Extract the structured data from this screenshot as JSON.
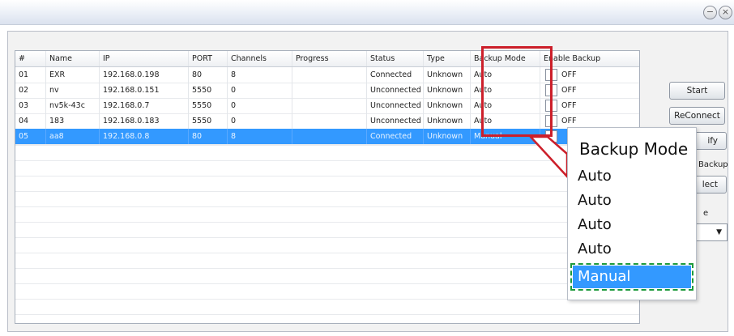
{
  "window": {
    "minimize_icon": "minimize-icon",
    "close_icon": "close-icon"
  },
  "table": {
    "headers": [
      "#",
      "Name",
      "IP",
      "PORT",
      "Channels",
      "Progress",
      "Status",
      "Type",
      "Backup Mode",
      "Enable Backup"
    ],
    "rows": [
      {
        "num": "01",
        "name": "EXR",
        "ip": "192.168.0.198",
        "port": "80",
        "channels": "8",
        "progress": "",
        "status": "Connected",
        "type": "Unknown",
        "backup_mode": "Auto",
        "enable_backup": "OFF"
      },
      {
        "num": "02",
        "name": "nv",
        "ip": "192.168.0.151",
        "port": "5550",
        "channels": "0",
        "progress": "",
        "status": "Unconnected",
        "type": "Unknown",
        "backup_mode": "Auto",
        "enable_backup": "OFF"
      },
      {
        "num": "03",
        "name": "nv5k-43c",
        "ip": "192.168.0.7",
        "port": "5550",
        "channels": "0",
        "progress": "",
        "status": "Unconnected",
        "type": "Unknown",
        "backup_mode": "Auto",
        "enable_backup": "OFF"
      },
      {
        "num": "04",
        "name": "183",
        "ip": "192.168.0.183",
        "port": "5550",
        "channels": "0",
        "progress": "",
        "status": "Unconnected",
        "type": "Unknown",
        "backup_mode": "Auto",
        "enable_backup": "OFF"
      },
      {
        "num": "05",
        "name": "aa8",
        "ip": "192.168.0.8",
        "port": "80",
        "channels": "8",
        "progress": "",
        "status": "Connected",
        "type": "Unknown",
        "backup_mode": "Manual",
        "enable_backup": "",
        "selected": true
      }
    ]
  },
  "side": {
    "start_label": "Start",
    "reconnect_label": "ReConnect",
    "modify_label_fragment": "ify",
    "backup_label_fragment": "Backup",
    "select_label_fragment": "lect",
    "type_label_fragment": "e"
  },
  "popup": {
    "title": "Backup Mode",
    "options": [
      "Auto",
      "Auto",
      "Auto",
      "Auto",
      "Manual"
    ]
  },
  "colors": {
    "highlight_border": "#cc1f2a",
    "selection": "#3399ff",
    "dashed_focus": "#1e9a3c"
  }
}
